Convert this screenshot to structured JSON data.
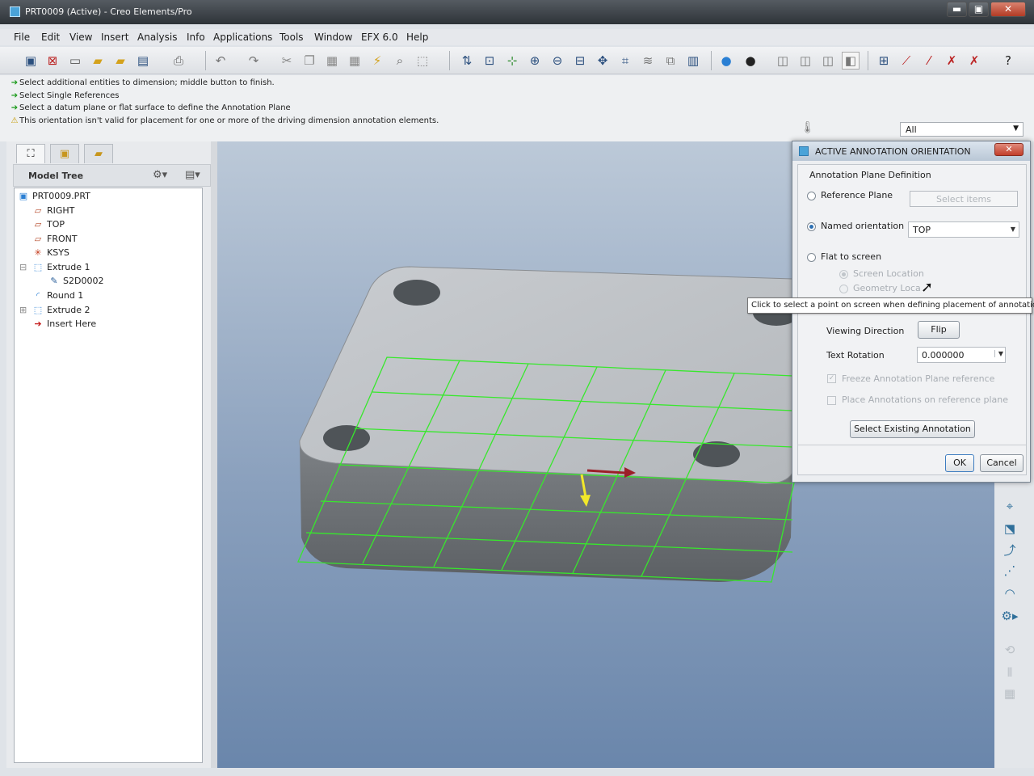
{
  "window": {
    "title": "PRT0009 (Active) - Creo Elements/Pro",
    "min": "▬",
    "max": "▣",
    "close": "✕"
  },
  "menu": [
    "File",
    "Edit",
    "View",
    "Insert",
    "Analysis",
    "Info",
    "Applications",
    "Tools",
    "Window",
    "EFX 6.0",
    "Help"
  ],
  "toolbar_icons": [
    "new-icon",
    "open-icon",
    "open-folder-icon",
    "save-icon",
    "print-icon",
    "undo-icon",
    "redo-icon",
    "cut-icon",
    "copy-icon",
    "paste-icon",
    "regenerate-icon",
    "zoom-in-icon",
    "zoom-out-icon",
    "refit-icon",
    "orient-icon",
    "datum-icon",
    "help-icon"
  ],
  "messages": [
    {
      "icon": "➔",
      "text": "Select additional entities to dimension; middle button to finish."
    },
    {
      "icon": "➔",
      "text": "Select Single References"
    },
    {
      "icon": "➔",
      "text": "Select a datum plane or flat surface to define the Annotation Plane"
    },
    {
      "icon": "⚠",
      "text": "This orientation isn't valid for placement for one or more of the driving dimension annotation elements."
    }
  ],
  "filter": {
    "value": "All"
  },
  "model_tree": {
    "header": "Model Tree",
    "items": [
      {
        "label": "PRT0009.PRT",
        "icon": "part-icon"
      },
      {
        "label": "RIGHT",
        "icon": "datum-plane-icon"
      },
      {
        "label": "TOP",
        "icon": "datum-plane-icon"
      },
      {
        "label": "FRONT",
        "icon": "datum-plane-icon"
      },
      {
        "label": "KSYS",
        "icon": "csys-icon"
      },
      {
        "label": "Extrude 1",
        "icon": "extrude-icon"
      },
      {
        "label": "S2D0002",
        "icon": "sketch-icon"
      },
      {
        "label": "Round 1",
        "icon": "round-icon"
      },
      {
        "label": "Extrude 2",
        "icon": "extrude-icon"
      },
      {
        "label": "Insert Here",
        "icon": "insert-arrow-icon"
      }
    ]
  },
  "dialog": {
    "title": "ACTIVE ANNOTATION ORIENTATION",
    "group_label": "Annotation Plane Definition",
    "reference_plane": "Reference Plane",
    "select_items": "Select items",
    "named_orientation": "Named orientation",
    "named_value": "TOP",
    "flat_to_screen": "Flat to screen",
    "screen_location": "Screen Location",
    "geometry_location": "Geometry Loca",
    "viewing_direction": "Viewing Direction",
    "flip": "Flip",
    "text_rotation": "Text Rotation",
    "rotation_value": "0.000000",
    "freeze": "Freeze Annotation Plane reference",
    "place_on_ref": "Place Annotations on reference plane",
    "select_existing": "Select Existing Annotation",
    "ok": "OK",
    "cancel": "Cancel"
  },
  "tooltip": "Click to select a point on screen when defining placement of annotation.",
  "colors": {
    "grid": "#37e82c",
    "direction_arrow": "#9c1f28",
    "dimension_arrow": "#f2e82a",
    "accent": "#2d6fb3"
  }
}
